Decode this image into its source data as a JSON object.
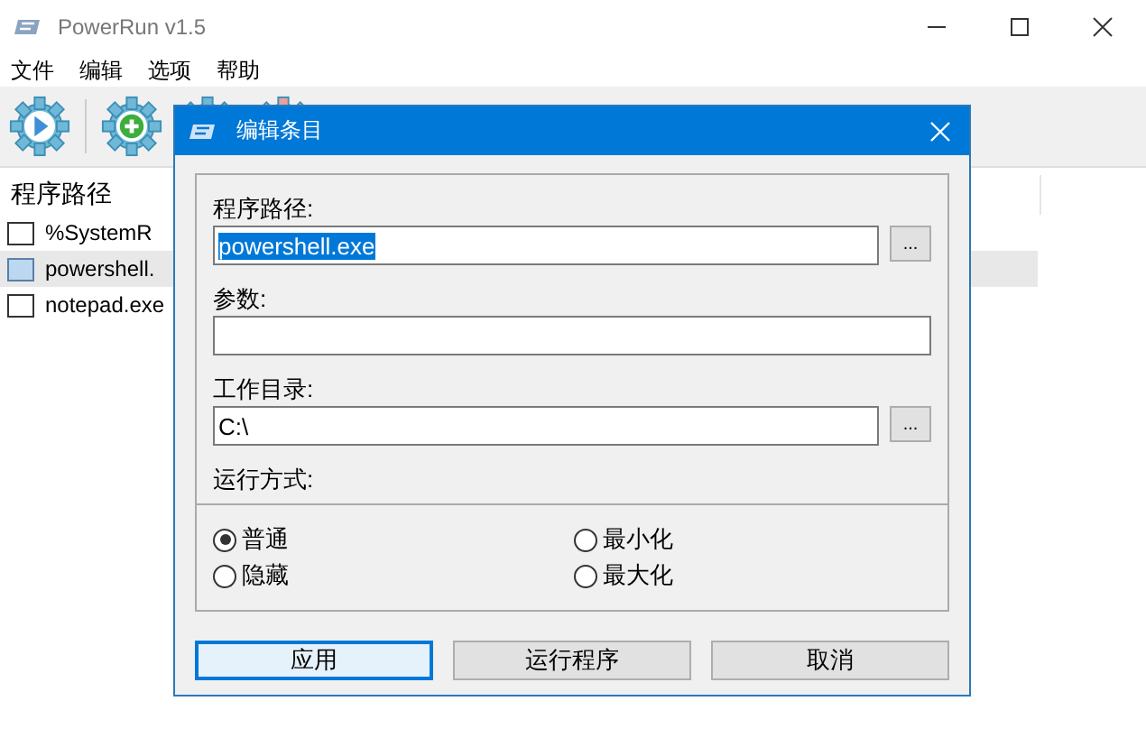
{
  "window": {
    "title": "PowerRun v1.5"
  },
  "menu": [
    "文件",
    "编辑",
    "选项",
    "帮助"
  ],
  "list": {
    "header": "程序路径",
    "rows": [
      {
        "text": "%SystemR",
        "selected": false
      },
      {
        "text": "powershell.",
        "selected": true
      },
      {
        "text": "notepad.exe",
        "selected": false
      }
    ]
  },
  "dialog": {
    "title": "编辑条目",
    "fields": [
      {
        "label": "程序路径:",
        "value": "powershell.exe",
        "text_selected": true,
        "browse": "..."
      },
      {
        "label": "参数:"
      },
      {
        "label": "工作目录:",
        "value": "C:\\",
        "text_selected": false,
        "browse": "..."
      }
    ],
    "mode_label": "运行方式:",
    "modes": [
      {
        "label": "普通",
        "selected": true
      },
      {
        "label": "最小化",
        "selected": false
      },
      {
        "label": "隐藏",
        "selected": false
      },
      {
        "label": "最大化",
        "selected": false
      }
    ],
    "buttons": [
      {
        "label": "应用",
        "focused": true
      },
      {
        "label": "运行程序",
        "focused": false
      },
      {
        "label": "取消",
        "focused": false
      }
    ]
  }
}
